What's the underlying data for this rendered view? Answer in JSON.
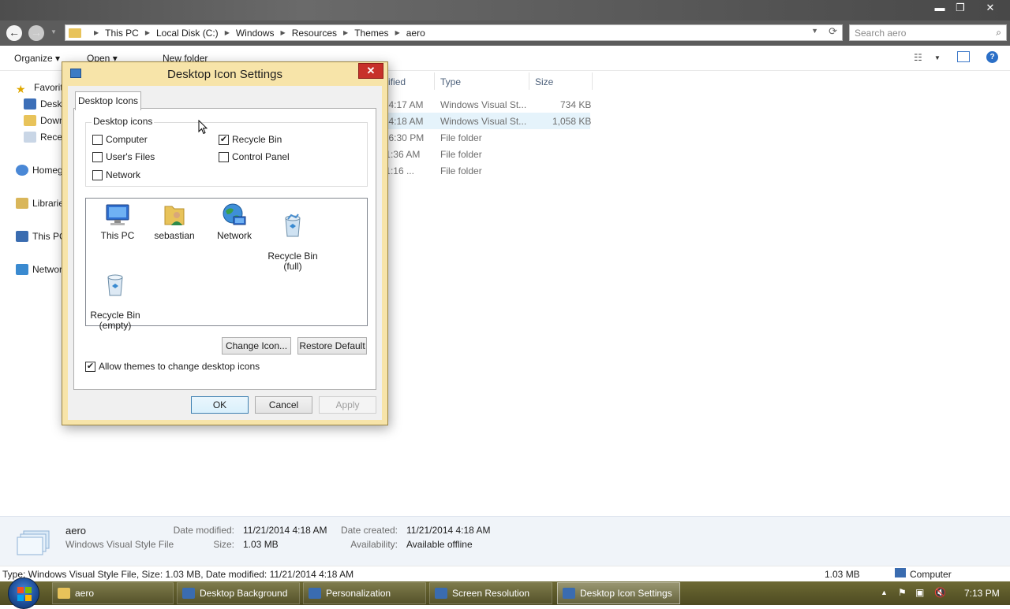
{
  "explorer": {
    "window_controls": {
      "minimize": "▬",
      "maximize": "❐",
      "close": "✕"
    },
    "nav": {
      "back": "←",
      "forward": "→",
      "recent": "▼"
    },
    "breadcrumbs": [
      "This PC",
      "Local Disk (C:)",
      "Windows",
      "Resources",
      "Themes",
      "aero"
    ],
    "address_dropdown": "▼",
    "refresh": "⟳",
    "search": {
      "placeholder": "Search aero",
      "icon": "⌕"
    },
    "toolbar": {
      "organize": "Organize ▾",
      "open": "Open ▾",
      "new_folder": "New folder",
      "views": "☷",
      "views_dd": "▼",
      "help": "?"
    },
    "nav_pane": {
      "favorites": "Favorites",
      "desktop": "Desktop",
      "downloads": "Downloads",
      "recent": "Recent places",
      "homegroup": "Homegroup",
      "libraries": "Libraries",
      "this_pc": "This PC",
      "network": "Network"
    },
    "columns": {
      "modified": "Date modified",
      "type": "Type",
      "size": "Size"
    },
    "files": [
      {
        "modified": "11/21/2014 4:17 AM",
        "type": "Windows Visual St...",
        "size": "734 KB"
      },
      {
        "modified": "11/21/2014 4:18 AM",
        "type": "Windows Visual St...",
        "size": "1,058 KB",
        "selected": true
      },
      {
        "modified": "11/21/2014 6:30 PM",
        "type": "File folder",
        "size": ""
      },
      {
        "modified": "11/21/2014 11:36 AM",
        "type": "File folder",
        "size": ""
      },
      {
        "modified": "11/21/2014 11:16 ...",
        "type": "File folder",
        "size": ""
      }
    ],
    "details": {
      "name": "aero",
      "kind": "Windows Visual Style File",
      "date_modified_label": "Date modified:",
      "date_modified": "11/21/2014 4:18 AM",
      "size_label": "Size:",
      "size": "1.03 MB",
      "date_created_label": "Date created:",
      "date_created": "11/21/2014 4:18 AM",
      "availability_label": "Availability:",
      "availability": "Available offline"
    },
    "statusbar": {
      "summary": "Type: Windows Visual Style File, Size: 1.03 MB, Date modified: 11/21/2014 4:18 AM",
      "size": "1.03 MB",
      "location": "Computer"
    }
  },
  "dialog": {
    "title": "Desktop Icon Settings",
    "close": "✕",
    "tab": "Desktop Icons",
    "group_label": "Desktop icons",
    "checkboxes": [
      {
        "label": "Computer",
        "checked": false
      },
      {
        "label": "User's Files",
        "checked": false
      },
      {
        "label": "Network",
        "checked": false
      },
      {
        "label": "Recycle Bin",
        "checked": true
      },
      {
        "label": "Control Panel",
        "checked": false
      }
    ],
    "icons": [
      {
        "label": "This PC",
        "icon": "monitor-icon"
      },
      {
        "label": "sebastian",
        "icon": "user-folder-icon"
      },
      {
        "label": "Network",
        "icon": "network-globe-icon"
      },
      {
        "label": "Recycle Bin\n(full)",
        "icon": "recycle-bin-full-icon"
      },
      {
        "label": "Recycle Bin\n(empty)",
        "icon": "recycle-bin-empty-icon"
      }
    ],
    "change_icon": "Change Icon...",
    "restore_default": "Restore Default",
    "allow_themes": {
      "label": "Allow themes to change desktop icons",
      "checked": true
    },
    "ok": "OK",
    "cancel": "Cancel",
    "apply": "Apply"
  },
  "taskbar": {
    "buttons": [
      {
        "label": "aero",
        "active": false
      },
      {
        "label": "Desktop Background",
        "active": false
      },
      {
        "label": "Personalization",
        "active": false
      },
      {
        "label": "Screen Resolution",
        "active": false
      },
      {
        "label": "Desktop Icon Settings",
        "active": true
      }
    ],
    "tray": {
      "expand": "▲",
      "flag": "⚑",
      "network": "▣",
      "volume": "🔇"
    },
    "clock": "7:13 PM"
  },
  "colors": {
    "taskbar": "#5d5a2a",
    "dialog_frame": "#f7e4a9",
    "close_red": "#c7312a",
    "selection": "#e5f3fb"
  }
}
